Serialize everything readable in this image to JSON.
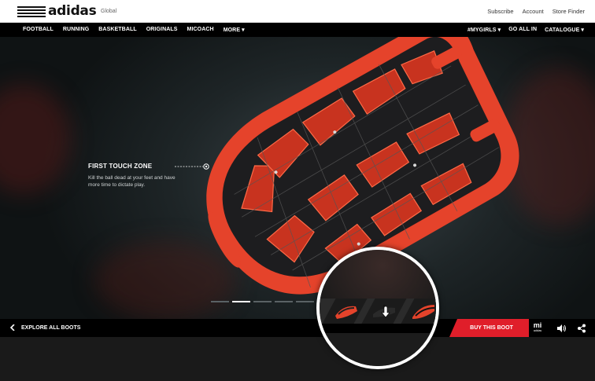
{
  "header": {
    "brand": "adidas",
    "region": "Global",
    "utility_links": [
      "Subscribe",
      "Account",
      "Store Finder"
    ]
  },
  "nav": {
    "left": [
      "FOOTBALL",
      "RUNNING",
      "BASKETBALL",
      "ORIGINALS",
      "MICOACH",
      "MORE ▾"
    ],
    "right": [
      "#MYGIRLS ▾",
      "GO ALL IN",
      "CATALOGUE ▾"
    ]
  },
  "hero": {
    "callout_title": "FIRST TOUCH ZONE",
    "callout_text": "Kill the ball dead at your feet and have more time to dictate play.",
    "pager_count": 5,
    "pager_active": 1
  },
  "bottom_bar": {
    "explore_label": "EXPLORE ALL BOOTS",
    "buy_label": "BUY THIS BOOT",
    "mi_logo": "mi",
    "mi_sub": "adidas",
    "icons": [
      "chevron-left-icon",
      "speaker-icon",
      "share-icon"
    ]
  },
  "colors": {
    "accent": "#e01e2a",
    "boot": "#e5432b",
    "background": "#1e2527"
  }
}
